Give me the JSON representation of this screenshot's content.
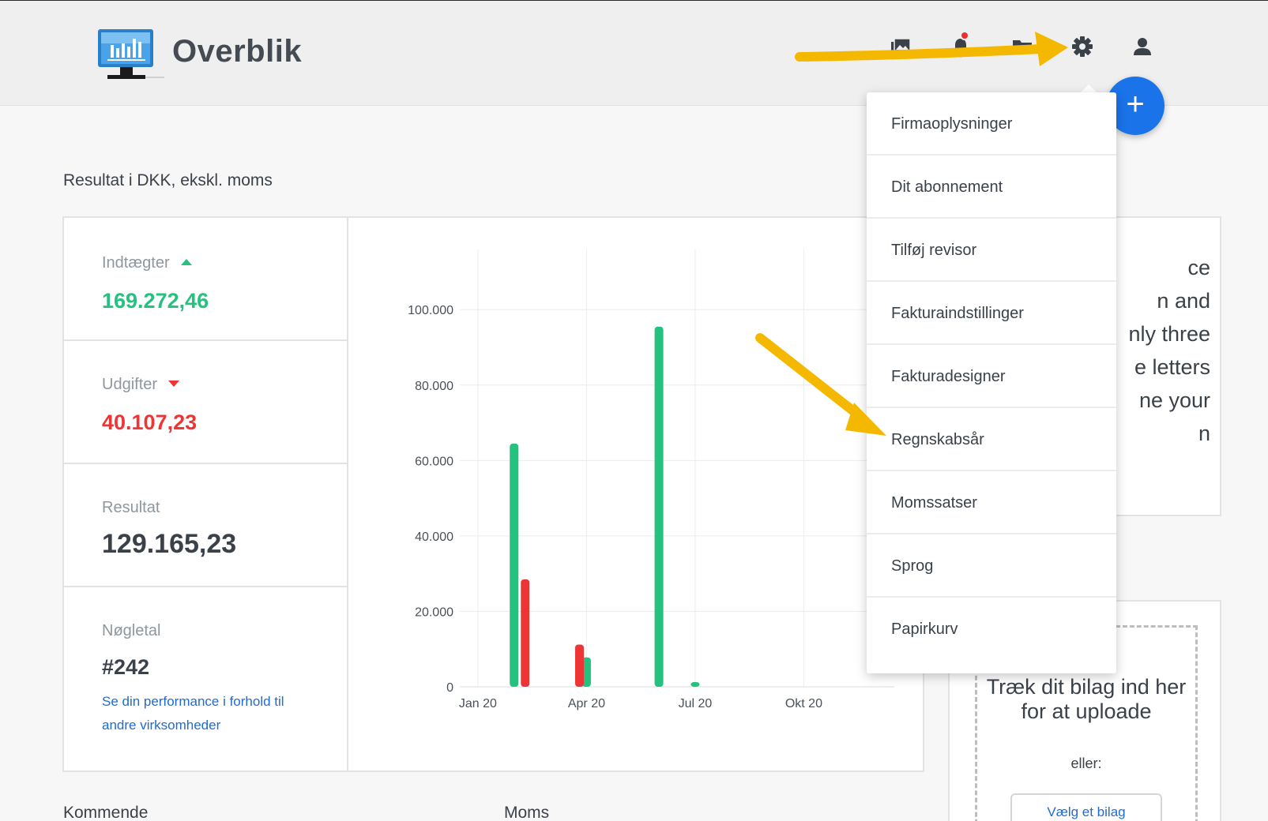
{
  "app": {
    "title": "Overblik"
  },
  "header": {
    "icons": [
      "photos-icon",
      "bell-icon",
      "folder-icon",
      "gear-icon",
      "user-icon"
    ],
    "fab_label": "+"
  },
  "section": {
    "title": "Resultat i DKK, ekskl. moms"
  },
  "stats": {
    "income": {
      "label": "Indtægter",
      "value": "169.272,46"
    },
    "expenses": {
      "label": "Udgifter",
      "value": "40.107,23"
    },
    "result": {
      "label": "Resultat",
      "value": "129.165,23"
    },
    "keyfigures": {
      "label": "Nøgletal",
      "value": "#242",
      "link": "Se din performance i forhold til andre virksomheder"
    }
  },
  "colors": {
    "income": "#25c17e",
    "expenses": "#ee3535",
    "accent": "#1a73e8",
    "arrow": "#f5b800"
  },
  "chart_data": {
    "type": "bar",
    "x_tick_labels": [
      "Jan 20",
      "Apr 20",
      "Jul 20",
      "Okt 20"
    ],
    "y_tick_labels": [
      "0",
      "20.000",
      "40.000",
      "60.000",
      "80.000",
      "100.000"
    ],
    "ylim": [
      0,
      108000
    ],
    "xlim": [
      0.5,
      12.5
    ],
    "series": [
      {
        "key": "income",
        "values": [
          {
            "x": 2,
            "y": 64500
          },
          {
            "x": 4,
            "y": 7800
          },
          {
            "x": 6,
            "y": 95500
          },
          {
            "x": 7,
            "y": 1200
          }
        ]
      },
      {
        "key": "expenses",
        "values": [
          {
            "x": 2,
            "y": 28500
          },
          {
            "x": 3.5,
            "y": 11200
          }
        ]
      }
    ],
    "grid": true
  },
  "right_card": {
    "lines": [
      "ce",
      "n and",
      "nly three",
      "e letters",
      "ne your",
      "n"
    ]
  },
  "upload": {
    "drop_text": "Træk dit bilag ind her for at uploade",
    "or_text": "eller:",
    "button_label": "Vælg et bilag"
  },
  "bottom": {
    "left_label": "Kommende",
    "right_label": "Moms"
  },
  "settings_menu": {
    "items": [
      "Firmaoplysninger",
      "Dit abonnement",
      "Tilføj revisor",
      "Fakturaindstillinger",
      "Fakturadesigner",
      "Regnskabsår",
      "Momssatser",
      "Sprog",
      "Papirkurv"
    ]
  }
}
